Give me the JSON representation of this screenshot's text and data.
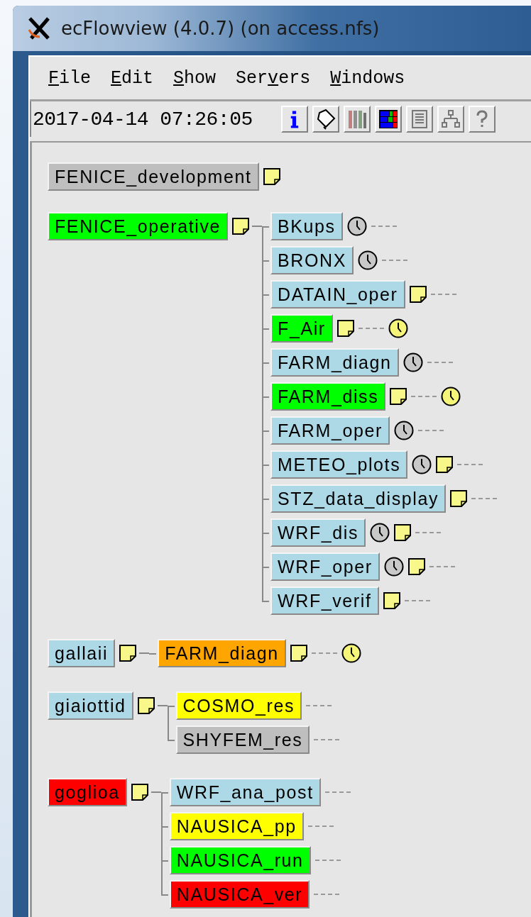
{
  "window": {
    "title": "ecFlowview (4.0.7) (on access.nfs)"
  },
  "menu": [
    {
      "key": "F",
      "after": "ile"
    },
    {
      "key": "E",
      "after": "dit"
    },
    {
      "key": "S",
      "after": "how"
    },
    {
      "before": "Ser",
      "key": "v",
      "after": "ers"
    },
    {
      "key": "W",
      "after": "indows"
    }
  ],
  "toolbar": {
    "datetime": "2017-04-14 07:26:05",
    "tools": [
      {
        "kind": "info"
      },
      {
        "kind": "tag"
      },
      {
        "kind": "bars"
      },
      {
        "kind": "grid"
      },
      {
        "kind": "list"
      },
      {
        "kind": "tree"
      },
      {
        "kind": "help"
      }
    ]
  },
  "tree": [
    {
      "name": "FENICE_development",
      "color": "#bebebe",
      "icons": [
        {
          "kind": "note"
        }
      ]
    },
    {
      "name": "FENICE_operative",
      "color": "#00ff00",
      "icons": [
        {
          "kind": "note"
        }
      ],
      "children": [
        {
          "name": "BKups",
          "color": "#add8e6",
          "icons": [
            {
              "kind": "clock"
            }
          ]
        },
        {
          "name": "BRONX",
          "color": "#add8e6",
          "icons": [
            {
              "kind": "clock"
            }
          ]
        },
        {
          "name": "DATAIN_oper",
          "color": "#add8e6",
          "icons": [
            {
              "kind": "note"
            }
          ]
        },
        {
          "name": "F_Air",
          "color": "#00ff00",
          "icons": [
            {
              "kind": "note"
            }
          ],
          "after": [
            {
              "kind": "clock_due"
            }
          ]
        },
        {
          "name": "FARM_diagn",
          "color": "#add8e6",
          "icons": [
            {
              "kind": "clock"
            }
          ]
        },
        {
          "name": "FARM_diss",
          "color": "#00ff00",
          "icons": [
            {
              "kind": "note"
            }
          ],
          "after": [
            {
              "kind": "clock_due"
            }
          ]
        },
        {
          "name": "FARM_oper",
          "color": "#add8e6",
          "icons": [
            {
              "kind": "clock"
            }
          ]
        },
        {
          "name": "METEO_plots",
          "color": "#add8e6",
          "icons": [
            {
              "kind": "clock"
            },
            {
              "kind": "note"
            }
          ]
        },
        {
          "name": "STZ_data_display",
          "color": "#add8e6",
          "icons": [
            {
              "kind": "note"
            }
          ]
        },
        {
          "name": "WRF_dis",
          "color": "#add8e6",
          "icons": [
            {
              "kind": "clock"
            },
            {
              "kind": "note"
            }
          ]
        },
        {
          "name": "WRF_oper",
          "color": "#add8e6",
          "icons": [
            {
              "kind": "clock"
            },
            {
              "kind": "note"
            }
          ]
        },
        {
          "name": "WRF_verif",
          "color": "#add8e6",
          "icons": [
            {
              "kind": "note"
            }
          ]
        }
      ]
    },
    {
      "name": "gallaii",
      "color": "#add8e6",
      "icons": [
        {
          "kind": "note"
        }
      ],
      "children": [
        {
          "name": "FARM_diagn",
          "color": "#ffa500",
          "icons": [
            {
              "kind": "note"
            }
          ],
          "after": [
            {
              "kind": "clock_due"
            }
          ]
        }
      ]
    },
    {
      "name": "giaiottid",
      "color": "#add8e6",
      "icons": [
        {
          "kind": "note"
        }
      ],
      "children": [
        {
          "name": "COSMO_res",
          "color": "#ffff00"
        },
        {
          "name": "SHYFEM_res",
          "color": "#bebebe"
        }
      ]
    },
    {
      "name": "goglioa",
      "color": "#ff0000",
      "icons": [
        {
          "kind": "note"
        }
      ],
      "children": [
        {
          "name": "WRF_ana_post",
          "color": "#add8e6"
        },
        {
          "name": "NAUSICA_pp",
          "color": "#ffff00"
        },
        {
          "name": "NAUSICA_run",
          "color": "#00ff00"
        },
        {
          "name": "NAUSICA_ver",
          "color": "#ff0000"
        }
      ]
    }
  ]
}
